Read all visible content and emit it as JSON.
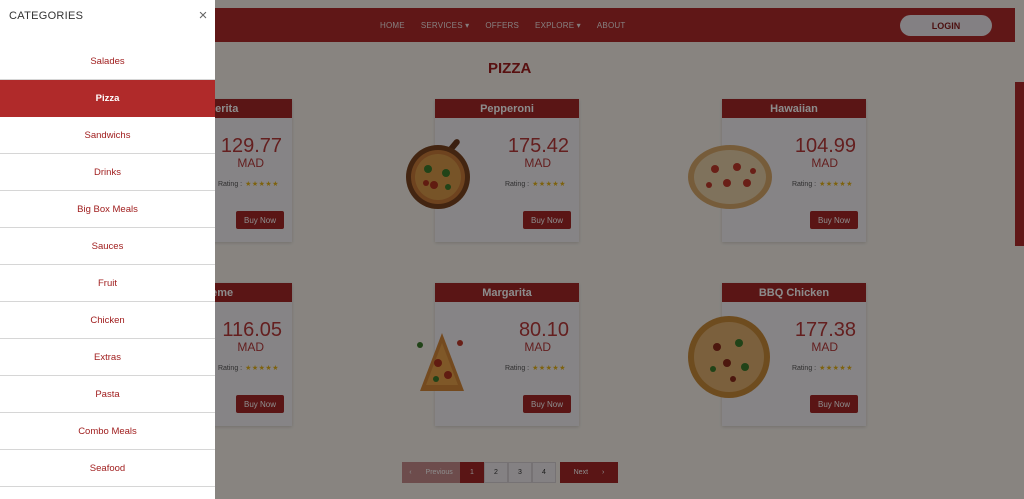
{
  "nav": {
    "items": [
      "HOME",
      "SERVICES ▾",
      "OFFERS",
      "EXPLORE ▾",
      "ABOUT"
    ],
    "login_label": "LOGIN"
  },
  "section_title": "PIZZA",
  "products": [
    {
      "name": "Margherita",
      "shown_name": "gherita",
      "price": "129.77",
      "currency": "MAD",
      "rating_label": "Rating :",
      "stars": "★★★★★",
      "buy_label": "Buy Now"
    },
    {
      "name": "Pepperoni",
      "shown_name": "Pepperoni",
      "price": "175.42",
      "currency": "MAD",
      "rating_label": "Rating :",
      "stars": "★★★★★",
      "buy_label": "Buy Now"
    },
    {
      "name": "Hawaiian",
      "shown_name": "Hawaiian",
      "price": "104.99",
      "currency": "MAD",
      "rating_label": "Rating :",
      "stars": "★★★★★",
      "buy_label": "Buy Now"
    },
    {
      "name": "Supreme",
      "shown_name": "reme",
      "price": "116.05",
      "currency": "MAD",
      "rating_label": "Rating :",
      "stars": "★★★★★",
      "buy_label": "Buy Now"
    },
    {
      "name": "Margarita",
      "shown_name": "Margarita",
      "price": "80.10",
      "currency": "MAD",
      "rating_label": "Rating :",
      "stars": "★★★★★",
      "buy_label": "Buy Now"
    },
    {
      "name": "BBQ Chicken",
      "shown_name": "BBQ Chicken",
      "price": "177.38",
      "currency": "MAD",
      "rating_label": "Rating :",
      "stars": "★★★★★",
      "buy_label": "Buy Now"
    }
  ],
  "pagination": {
    "prev_label": "Previous",
    "pages": [
      "1",
      "2",
      "3",
      "4"
    ],
    "active_page": "1",
    "next_label": "Next"
  },
  "drawer": {
    "title": "CATEGORIES",
    "close_icon": "×",
    "active": "Pizza",
    "items": [
      "Salades",
      "Pizza",
      "Sandwichs",
      "Drinks",
      "Big Box Meals",
      "Sauces",
      "Fruit",
      "Chicken",
      "Extras",
      "Pasta",
      "Combo Meals",
      "Seafood"
    ]
  },
  "colors": {
    "brand": "#b02a2a",
    "star": "#e4b21a",
    "background": "#f7f1ea"
  }
}
